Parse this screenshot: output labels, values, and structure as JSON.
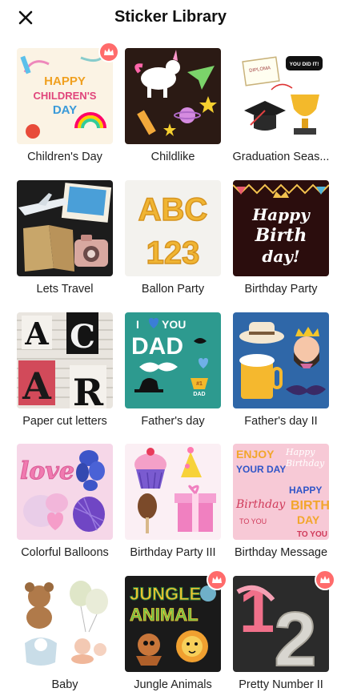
{
  "header": {
    "title": "Sticker Library",
    "close_icon": "close-icon"
  },
  "colors": {
    "premium_badge": "#ff6b6b",
    "title_text": "#111111"
  },
  "stickers": [
    {
      "label": "Children's Day",
      "premium": true
    },
    {
      "label": "Childlike",
      "premium": false
    },
    {
      "label": "Graduation Seas...",
      "premium": false
    },
    {
      "label": "Lets Travel",
      "premium": false
    },
    {
      "label": "Ballon Party",
      "premium": false
    },
    {
      "label": "Birthday Party",
      "premium": false
    },
    {
      "label": "Paper cut letters",
      "premium": false
    },
    {
      "label": "Father's day",
      "premium": false
    },
    {
      "label": "Father's day II",
      "premium": false
    },
    {
      "label": "Colorful Balloons",
      "premium": false
    },
    {
      "label": "Birthday Party III",
      "premium": false
    },
    {
      "label": "Birthday Message",
      "premium": false
    },
    {
      "label": "Baby",
      "premium": false
    },
    {
      "label": "Jungle Animals",
      "premium": true
    },
    {
      "label": "Pretty Number II",
      "premium": true
    }
  ],
  "thumb_text": {
    "childrens_day": [
      "HAPPY",
      "CHILDREN'S",
      "DAY"
    ],
    "graduation_badge": "YOU DID IT!",
    "graduation_diploma": "DIPLOMA",
    "ballon_letters": [
      "ABC",
      "123"
    ],
    "birthday_party": [
      "Happy",
      "Birth",
      "day!"
    ],
    "paper_cut": [
      "A",
      "C",
      "A",
      "R"
    ],
    "fathers_day": [
      "I",
      "YOU",
      "DAD",
      "#1",
      "DAD"
    ],
    "love": "love",
    "enjoy": [
      "ENJOY",
      "YOUR DAY"
    ],
    "birthday_message": [
      "Happy",
      "Birthday",
      "HAPPY",
      "BIRTH",
      "DAY",
      "TO YOU"
    ],
    "jungle": [
      "JUNGLE",
      "ANIMAL"
    ],
    "pretty_number": [
      "1",
      "2"
    ]
  }
}
